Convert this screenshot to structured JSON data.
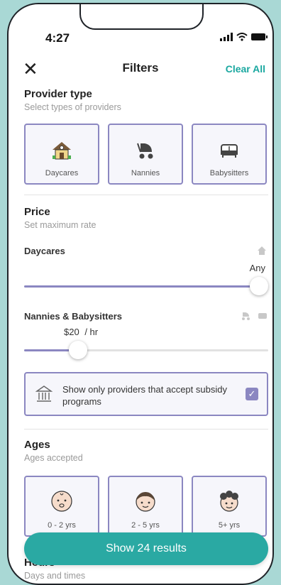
{
  "status": {
    "time": "4:27"
  },
  "header": {
    "title": "Filters",
    "clear": "Clear All"
  },
  "provider": {
    "title": "Provider type",
    "subtitle": "Select types of providers",
    "cards": [
      {
        "label": "Daycares",
        "icon": "house-icon"
      },
      {
        "label": "Nannies",
        "icon": "stroller-icon"
      },
      {
        "label": "Babysitters",
        "icon": "sofa-icon"
      }
    ]
  },
  "price": {
    "title": "Price",
    "subtitle": "Set maximum rate",
    "daycares": {
      "label": "Daycares",
      "value_text": "Any",
      "fraction": 1.0
    },
    "nannies": {
      "label": "Nannies & Babysitters",
      "value_text": "$20",
      "unit": "/ hr",
      "fraction": 0.22
    }
  },
  "subsidy": {
    "text": "Show only providers that accept subsidy programs",
    "checked": true
  },
  "ages": {
    "title": "Ages",
    "subtitle": "Ages accepted",
    "cards": [
      {
        "label": "0 - 2 yrs",
        "icon": "baby-face-icon"
      },
      {
        "label": "2 - 5 yrs",
        "icon": "toddler-face-icon"
      },
      {
        "label": "5+ yrs",
        "icon": "child-face-icon"
      }
    ]
  },
  "hours": {
    "title": "Hours",
    "subtitle": "Days and times"
  },
  "cta": {
    "label": "Show 24 results"
  },
  "colors": {
    "accent": "#8b87c1",
    "teal": "#2aa9a3"
  }
}
